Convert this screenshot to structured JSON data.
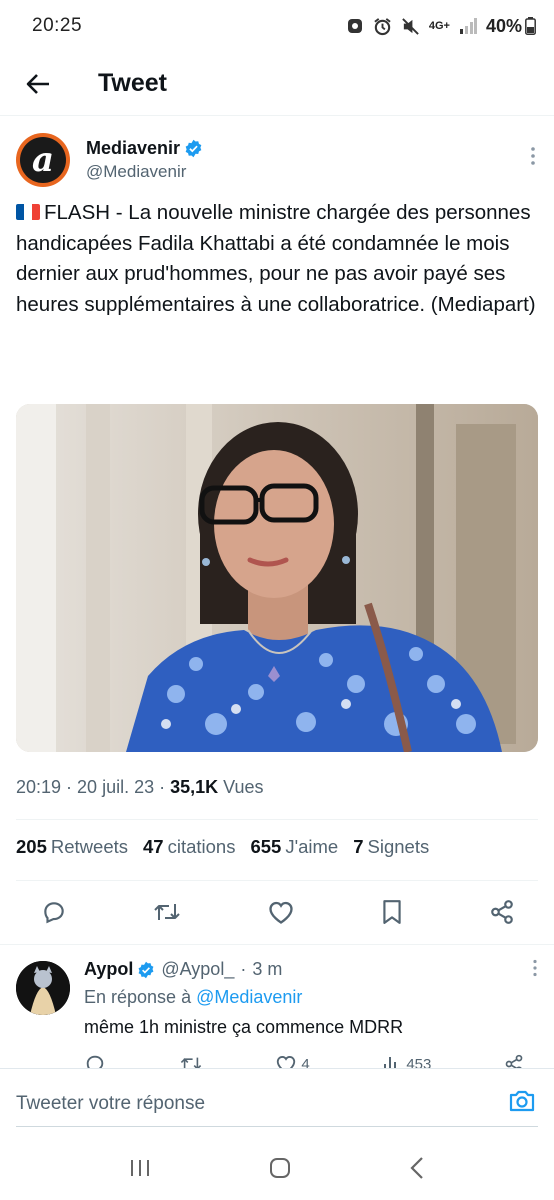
{
  "status_bar": {
    "time": "20:25",
    "network": "4G+",
    "battery": "40%"
  },
  "header": {
    "title": "Tweet"
  },
  "tweet": {
    "author_name": "Mediavenir",
    "author_handle": "@Mediavenir",
    "text": "FLASH - La nouvelle ministre chargée des personnes handicapées Fadila Khattabi a été condamnée le mois dernier aux prud'hommes, pour ne pas avoir payé ses heures supplémentaires à une collaboratrice. (Mediapart)",
    "time": "20:19",
    "date": "20 juil. 23",
    "views_count": "35,1K",
    "views_label": "Vues",
    "stats": [
      {
        "count": "205",
        "label": "Retweets"
      },
      {
        "count": "47",
        "label": "citations"
      },
      {
        "count": "655",
        "label": "J'aime"
      },
      {
        "count": "7",
        "label": "Signets"
      }
    ],
    "actions": [
      "reply-icon",
      "retweet-icon",
      "like-icon",
      "bookmark-icon",
      "share-icon"
    ]
  },
  "reply": {
    "author_name": "Aypol",
    "author_handle": "@Aypol_",
    "time_ago": "3 m",
    "in_reply_prefix": "En réponse à",
    "in_reply_to": "@Mediavenir",
    "text": "même 1h ministre ça commence MDRR",
    "likes": "4",
    "views": "453"
  },
  "compose": {
    "placeholder": "Tweeter votre réponse"
  },
  "colors": {
    "accent": "#1d9bf0",
    "text": "#0f1419",
    "secondary": "#536471",
    "avatar_orange": "#e8661f"
  }
}
